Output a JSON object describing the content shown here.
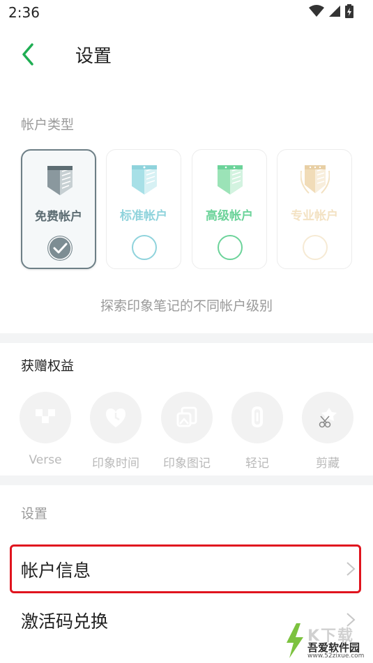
{
  "status_bar": {
    "time": "2:36"
  },
  "app_bar": {
    "title": "设置"
  },
  "account_type": {
    "label": "帐户类型",
    "cards": [
      {
        "label": "免费帐户",
        "color": "#5d6d73",
        "selected": true
      },
      {
        "label": "标准帐户",
        "color": "#8fd3dc",
        "selected": false
      },
      {
        "label": "高级帐户",
        "color": "#6cd39a",
        "selected": false
      },
      {
        "label": "专业帐户",
        "color": "#f3e2c3",
        "selected": false
      }
    ],
    "caption": "探索印象笔记的不同帐户级别"
  },
  "benefits": {
    "title": "获赠权益",
    "items": [
      {
        "label": "Verse",
        "icon": "verse-icon"
      },
      {
        "label": "印象时间",
        "icon": "heart-clock-icon"
      },
      {
        "label": "印象图记",
        "icon": "image-note-icon"
      },
      {
        "label": "轻记",
        "icon": "paperclip-icon"
      },
      {
        "label": "剪藏",
        "icon": "scissors-icon"
      }
    ]
  },
  "settings": {
    "label": "设置",
    "rows": [
      {
        "label": "帐户信息"
      },
      {
        "label": "激活码兑换"
      }
    ]
  },
  "watermark": {
    "line1": "K下载",
    "line2": "吾爱软件园",
    "line3": "www.52zixue.com"
  },
  "colors": {
    "accent": "#1fae53",
    "highlight": "#e0141e",
    "divider": "#f3f4f5"
  }
}
